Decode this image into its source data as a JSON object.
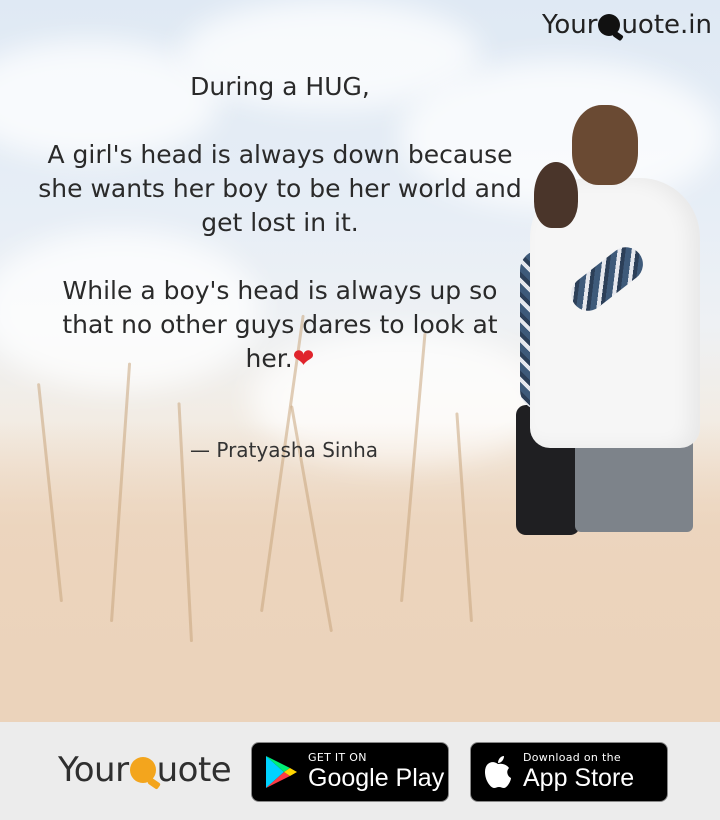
{
  "header": {
    "brand_left": "Your",
    "brand_right": "uote.in"
  },
  "quote": {
    "title": "During a HUG,",
    "para1_line1": "A girl's head is always down because",
    "para1_line2": "she wants her boy to be her world and",
    "para1_line3": "get lost in it.",
    "para2_line1": "While a boy's head is always up so",
    "para2_line2": "that no other guys dares to look at",
    "para2_line3": "her.",
    "heart": "❤"
  },
  "author": "— Pratyasha Sinha",
  "footer": {
    "brand_left": "Your",
    "brand_right": "uote",
    "google_play_small": "GET IT ON",
    "google_play_big": "Google Play",
    "app_store_small": "Download on the",
    "app_store_big": "App Store"
  },
  "colors": {
    "heart": "#e0242c",
    "brand_q": "#f3a51d"
  },
  "icons": [
    "google-play-icon",
    "apple-icon"
  ]
}
